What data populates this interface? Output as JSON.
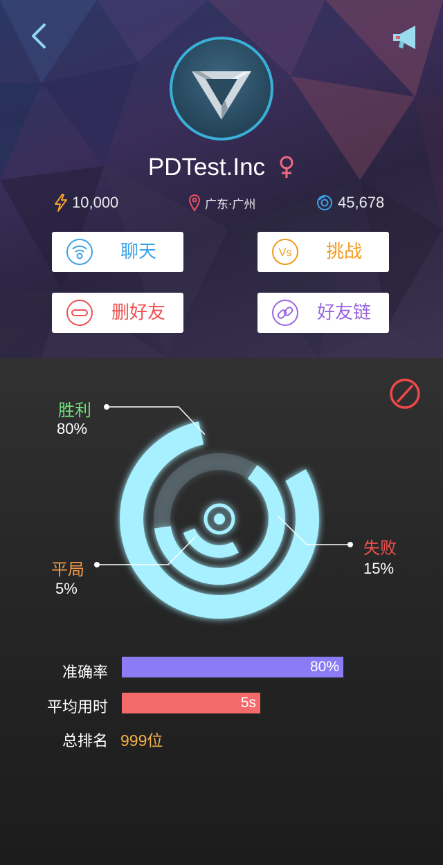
{
  "profile": {
    "username": "PDTest.Inc",
    "gender_symbol": "♀",
    "energy": "10,000",
    "location": "广东·广州",
    "coins": "45,678"
  },
  "actions": {
    "chat_label": "聊天",
    "challenge_label": "挑战",
    "challenge_icon_text": "Vs",
    "delete_friend_label": "删好友",
    "friend_link_label": "好友链"
  },
  "stats": {
    "win": {
      "label": "胜利",
      "percent": "80%",
      "value": 0.8
    },
    "loss": {
      "label": "失败",
      "percent": "15%",
      "value": 0.15
    },
    "draw": {
      "label": "平局",
      "percent": "5%",
      "value": 0.05
    }
  },
  "metrics": {
    "accuracy": {
      "label": "准确率",
      "value": "80%",
      "fraction": 0.8,
      "color": "#8b7cf6"
    },
    "avg_time": {
      "label": "平均用时",
      "value": "5s",
      "color": "#f46a6a"
    },
    "rank": {
      "label": "总排名",
      "value": "999位"
    }
  },
  "colors": {
    "chat": "#3aa3e8",
    "challenge": "#f09a1a",
    "delete": "#f05050",
    "friend_link": "#9966e0",
    "win": "#6fe07a",
    "loss": "#f05050",
    "draw": "#f09a4a",
    "ring": "#a6f0ff",
    "avatar_border": "#3ab0d8"
  }
}
